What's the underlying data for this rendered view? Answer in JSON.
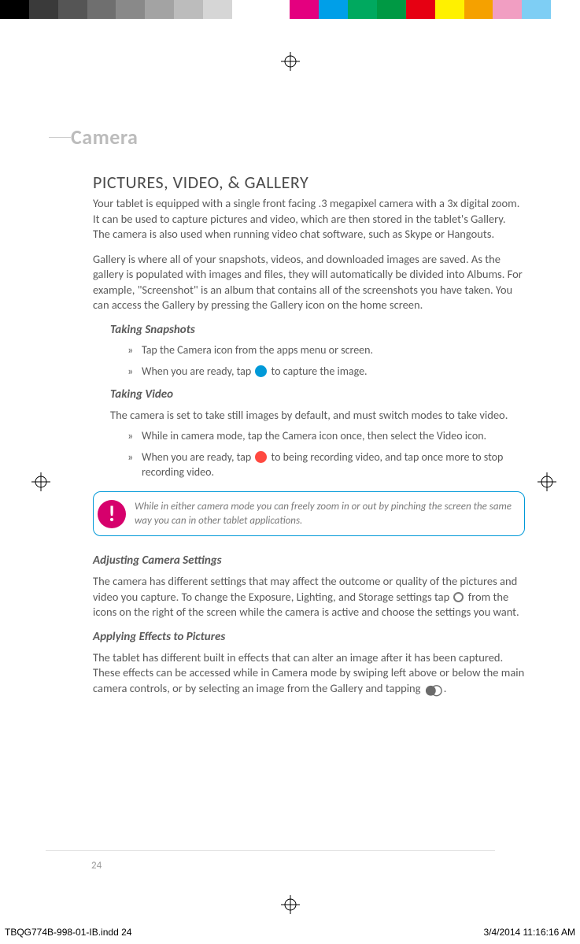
{
  "colorBar": [
    "#000000",
    "#3a3a3a",
    "#555555",
    "#6f6f6f",
    "#898989",
    "#a3a3a3",
    "#bcbcbc",
    "#d6d6d6",
    "#ffffff",
    "#ffffff",
    "#e4007f",
    "#009fe8",
    "#00a95f",
    "#009944",
    "#e60012",
    "#fff100",
    "#f5a100",
    "#f19ec2",
    "#7ecef4",
    "#ffffff"
  ],
  "sectionTitle": "Camera",
  "h2": "PICTURES, VIDEO, & GALLERY",
  "intro1": "Your tablet is equipped with a single front facing .3 megapixel camera with a 3x digital zoom. It can be used to capture pictures and video, which are then stored in the tablet's Gallery. The camera is also used when running video chat software, such as Skype or Hangouts.",
  "intro2": "Gallery is where all of your snapshots, videos, and downloaded images are saved. As the gallery is populated with images and files, they will automatically be divided into Albums. For example, \"Screenshot\" is an album that contains all of the screenshots you have taken. You can access the Gallery by pressing the Gallery icon on the home screen.",
  "takingSnapshotsHeading": "Taking Snapshots",
  "snap1": "Tap the Camera icon from the apps menu or screen.",
  "snap2a": "When you are ready, tap ",
  "snap2b": " to capture the image.",
  "takingVideoHeading": "Taking Video",
  "videoIntro": "The camera is set to take still images by default, and must switch modes to take video.",
  "video1": "While in camera mode, tap the Camera icon once, then select the Video icon.",
  "video2a": "When you are ready, tap ",
  "video2b": " to being recording video, and tap once more to stop recording video.",
  "calloutText": "While in either camera mode you can freely zoom in or out by pinching the screen the same way you can in other tablet applications.",
  "calloutMark": "!",
  "adjustHeading": "Adjusting Camera Settings",
  "adjustText1": "The camera has different settings that may affect the outcome or quality of the pictures and video you capture. To change the Exposure, Lighting, and Storage settings tap ",
  "adjustText2": " from the icons on the right of the screen while the camera is active and choose the settings you want.",
  "effectsHeading": "Applying Effects to Pictures",
  "effectsText1": "The tablet has different built in effects that can alter an image after it has been captured. These effects can be accessed while in Camera mode by swiping left above or below the main camera controls, or by selecting an image from the Gallery and tapping ",
  "effectsText2": ".",
  "pageNumber": "24",
  "footerLeft": "TBQG774B-998-01-IB.indd   24",
  "footerRight": "3/4/2014   11:16:16 AM"
}
